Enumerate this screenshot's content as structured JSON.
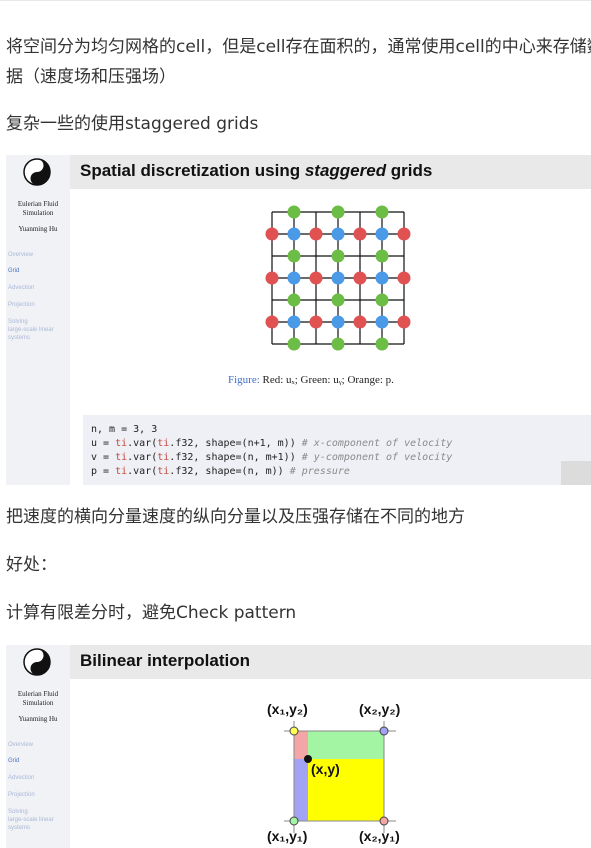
{
  "paragraphs": {
    "p1": "将空间分为均匀网格的cell，但是cell存在面积的，通常使用cell的中心来存储数据（速度场和压强场）",
    "p2": "复杂一些的使用staggered grids",
    "p3": "把速度的横向分量速度的纵向分量以及压强存储在不同的地方",
    "p4": "好处：",
    "p5": "计算有限差分时，避免Check pattern"
  },
  "slide1": {
    "title_a": "Spatial discretization using ",
    "title_em": "staggered",
    "title_b": " grids",
    "sidebar_name_1": "Eulerian Fluid",
    "sidebar_name_2": "Simulation",
    "sidebar_author": "Yuanming Hu",
    "nav": [
      "Overview",
      "Grid",
      "Advection",
      "Projection",
      "Solving",
      "large-scale linear",
      "systems"
    ],
    "caption_label": "Figure:",
    "caption_text": " Red: uₓ; Green: uᵧ; Orange: p.",
    "code": {
      "line1": "n, m = 3, 3",
      "l2a": "u = ",
      "l2ti": "ti",
      "l2b": ".var(",
      "l2ti2": "ti",
      "l2c": ".f32, shape=(n+1, m)) ",
      "l2cm": "# x-component of velocity",
      "l3a": "v = ",
      "l3ti": "ti",
      "l3b": ".var(",
      "l3ti2": "ti",
      "l3c": ".f32, shape=(n, m+1)) ",
      "l3cm": "# y-component of velocity",
      "l4a": "p = ",
      "l4ti": "ti",
      "l4b": ".var(",
      "l4ti2": "ti",
      "l4c": ".f32, shape=(n, m)) ",
      "l4cm": "# pressure"
    }
  },
  "slide2": {
    "title": "Bilinear interpolation",
    "sidebar_name_1": "Eulerian Fluid",
    "sidebar_name_2": "Simulation",
    "sidebar_author": "Yuanming Hu",
    "nav": [
      "Overview",
      "Grid",
      "Advection",
      "Projection",
      "Solving",
      "large-scale linear",
      "systems"
    ],
    "labels": {
      "tl": "(x₁,y₂)",
      "tr": "(x₂,y₂)",
      "bl": "(x₁,y₁)",
      "br": "(x₂,y₁)",
      "center": "(x,y)"
    }
  },
  "colors": {
    "red": "#e05252",
    "green": "#6cbd45",
    "blue": "#4a9ae8",
    "yellow": "#ffff00",
    "light_green": "#a3f5a3",
    "pink": "#f4a5a5",
    "lavender": "#a3a3f5",
    "link_blue": "#3f6fc4"
  }
}
